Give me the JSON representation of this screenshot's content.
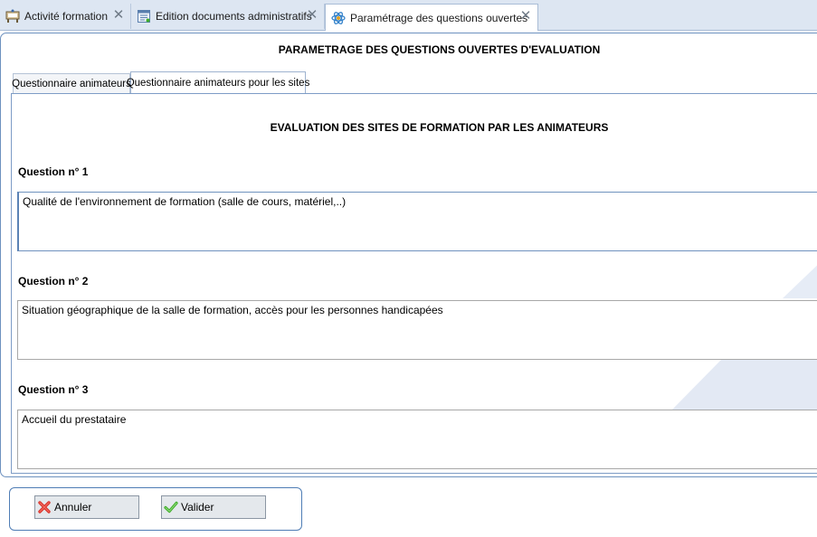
{
  "doc_tabs": [
    {
      "label": "Activité formation",
      "icon": "training-activity-icon"
    },
    {
      "label": "Edition documents administratifs",
      "icon": "document-edit-icon"
    },
    {
      "label": "Paramétrage des questions ouvertes",
      "icon": "settings-atom-icon"
    }
  ],
  "page": {
    "title": "PARAMETRAGE DES QUESTIONS OUVERTES D'EVALUATION"
  },
  "inner_tabs": [
    {
      "label": "Questionnaire animateurs"
    },
    {
      "label": "Questionnaire animateurs pour les sites"
    }
  ],
  "section": {
    "title": "EVALUATION DES SITES DE FORMATION PAR LES ANIMATEURS",
    "questions": [
      {
        "label": "Question n° 1",
        "value": "Qualité de l'environnement de formation (salle de cours, matériel,..)"
      },
      {
        "label": "Question n° 2",
        "value": "Situation géographique de la salle de formation, accès pour les personnes handicapées"
      },
      {
        "label": "Question n° 3",
        "value": "Accueil du prestataire"
      }
    ]
  },
  "buttons": {
    "cancel": "Annuler",
    "validate": "Valider"
  },
  "colors": {
    "accent": "#4f7db5",
    "tab_strip": "#dde6f2",
    "cancel_icon": "#d9342b",
    "validate_icon": "#3fae2a"
  }
}
